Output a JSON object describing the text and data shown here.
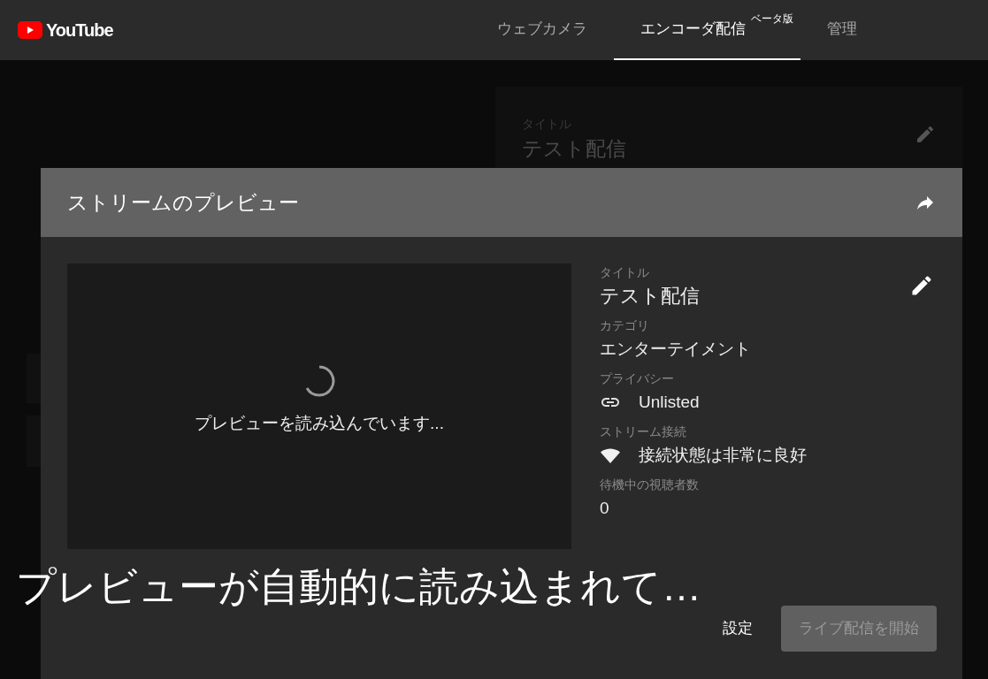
{
  "header": {
    "logo_text": "YouTube",
    "tabs": [
      {
        "label": "ウェブカメラ",
        "selected": false
      },
      {
        "label": "エンコーダ配信",
        "badge": "ベータ版",
        "selected": true
      },
      {
        "label": "管理",
        "selected": false
      }
    ]
  },
  "background_card": {
    "label": "タイトル",
    "value": "テスト配信"
  },
  "dialog": {
    "title": "ストリームのプレビュー",
    "preview": {
      "loading_text": "プレビューを読み込んでいます..."
    },
    "fields": [
      {
        "kind": "text",
        "label": "タイトル",
        "value": "テスト配信",
        "editable": true
      },
      {
        "kind": "text",
        "label": "カテゴリ",
        "value": "エンターテイメント",
        "editable": false
      },
      {
        "kind": "link",
        "label": "プライバシー",
        "value": "Unlisted",
        "editable": false
      },
      {
        "kind": "signal",
        "label": "ストリーム接続",
        "value": "接続状態は非常に良好",
        "editable": false
      },
      {
        "kind": "count",
        "label": "待機中の視聴者数",
        "value": "0",
        "editable": false
      }
    ],
    "buttons": [
      {
        "label": "設定",
        "kind": "text",
        "disabled": false
      },
      {
        "label": "ライブ配信を開始",
        "kind": "filled",
        "disabled": true
      }
    ]
  },
  "caption": "プレビューが自動的に読み込まれて…"
}
